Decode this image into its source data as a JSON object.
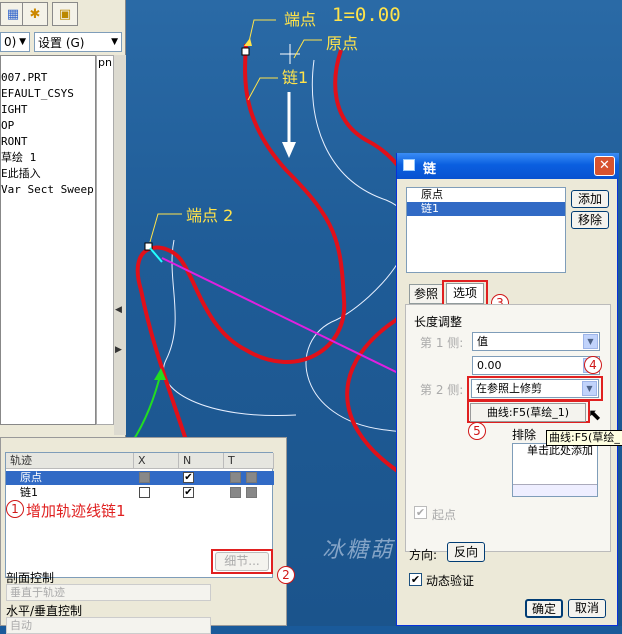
{
  "left_panel": {
    "combo_left": "0)",
    "combo_settings": "设置 (G)",
    "tree_col_header": "pn",
    "tree_items": [
      "007.PRT",
      "EFAULT_CSYS",
      "IGHT",
      "OP",
      "RONT",
      "草绘 1",
      "E此插入",
      "Var Sect Sweep"
    ]
  },
  "canvas": {
    "endpoint1_label": "端点",
    "dimension_label": "1=0.00",
    "origin_label": "原点",
    "chain1_label": "链1",
    "endpoint2_label": "端点 2",
    "watermark": "冰糖葫",
    "colors": {
      "trajectory": "#e0101a",
      "annotation_green": "#22dd22",
      "annotation_magenta": "#e020e0"
    }
  },
  "trajectory_panel": {
    "headers": [
      "轨迹",
      "X",
      "N",
      "T"
    ],
    "rows": [
      {
        "name": "原点",
        "x": "",
        "n": "✔"
      },
      {
        "name": "链1",
        "x": "",
        "n": "✔"
      }
    ],
    "note_number": "1",
    "note_text": "增加轨迹线链1",
    "details_button": "细节...",
    "details_marker": "2",
    "section_control_label": "剖面控制",
    "section_control_value": "垂直于轨迹",
    "hv_control_label": "水平/垂直控制",
    "hv_control_value": "自动"
  },
  "chain_dialog": {
    "title": "链",
    "list_items": [
      "原点",
      "链1"
    ],
    "add_button": "添加",
    "remove_button": "移除",
    "tab_references": "参照",
    "tab_options": "选项",
    "tab_marker": "3",
    "length_adjust_label": "长度调整",
    "side1_label": "第 1 侧:",
    "side1_value": "值",
    "side1_number": "0.00",
    "side1_marker": "4",
    "side2_label": "第 2 侧:",
    "side2_value": "在参照上修剪",
    "curve_ref_value": "曲线:F5(草绘_1)",
    "curve_marker": "5",
    "tooltip": "曲线:F5(草绘_",
    "exclude_label": "排除",
    "exclude_placeholder": "单击此处添加",
    "start_point_label": "起点",
    "direction_label": "方向:",
    "direction_button": "反向",
    "dynamic_verify_label": "动态验证",
    "ok_button": "确定",
    "cancel_button": "取消"
  }
}
